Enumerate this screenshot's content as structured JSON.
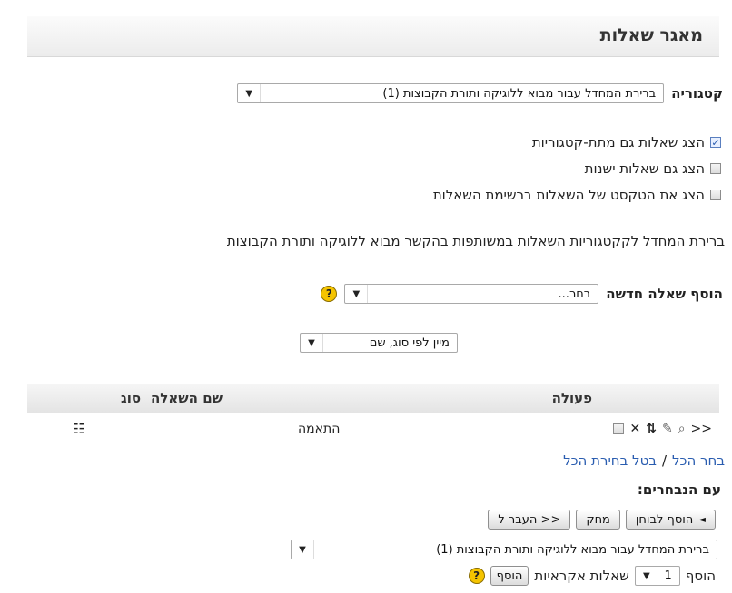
{
  "page": {
    "title": "מאגר שאלות"
  },
  "category": {
    "label": "קטגוריה",
    "selected": "ברירת המחדל עבור מבוא ללוגיקה ותורת הקבוצות (1)"
  },
  "options": [
    {
      "label": "הצג שאלות גם מתת-קטגוריות",
      "checked": true
    },
    {
      "label": "הצג גם שאלות ישנות",
      "checked": false
    },
    {
      "label": "הצג את הטקסט של השאלות ברשימת השאלות",
      "checked": false
    }
  ],
  "info_text": "ברירת המחדל לקקטגוריות השאלות במשותפות בהקשר מבוא ללוגיקה ותורת הקבוצות",
  "add_question": {
    "label": "הוסף שאלה חדשה",
    "selected": "בחר..."
  },
  "sort": {
    "selected": "מיין לפי סוג, שם"
  },
  "table": {
    "col_action": "פעולה",
    "col_name": "שם השאלה",
    "col_type": "סוג",
    "rows": [
      {
        "name": "התאמה",
        "type_icon": "matching-icon"
      }
    ]
  },
  "selection": {
    "select_all": "בחר הכל",
    "separator": "/",
    "deselect_all": "בטל בחירת הכל"
  },
  "with_selected": {
    "label": "עם הנבחרים:",
    "add_to_quiz": "הוסף לבוחן",
    "delete": "מחק",
    "move_to": "העבר ל >>",
    "target_category": "ברירת המחדל עבור מבוא ללוגיקה ותורת הקבוצות (1)"
  },
  "random": {
    "prefix": "הוסף",
    "count": "1",
    "suffix": "שאלות אקראיות",
    "add_button": "הוסף"
  }
}
